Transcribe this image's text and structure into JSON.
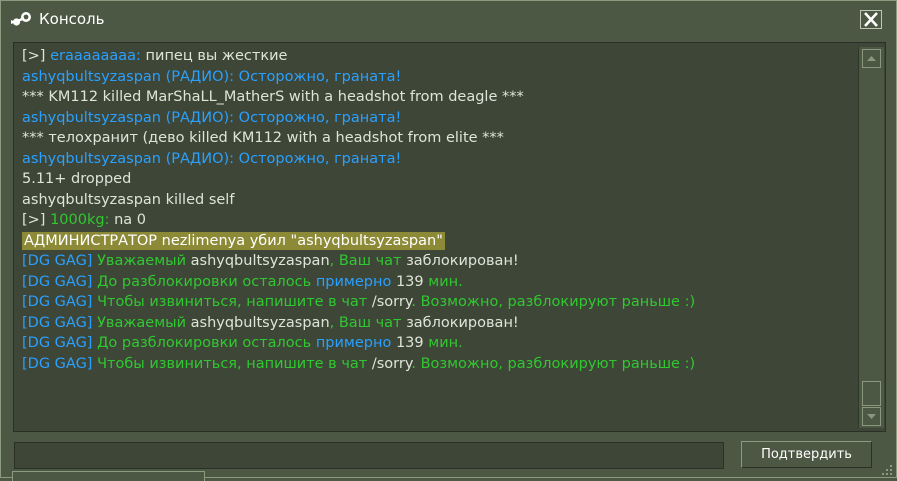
{
  "window": {
    "title": "Консоль",
    "icon": "steam-icon",
    "close_icon": "close-icon"
  },
  "colors": {
    "background": "#4c5844",
    "console_bg": "#3e4637",
    "text_default": "#dfe4d8",
    "radio_blue": "#2aa0ff",
    "green": "#30c830",
    "highlight_bg": "#8c8a37"
  },
  "console": {
    "lines": [
      [
        {
          "t": "[>] ",
          "c": "#dfe4d8"
        },
        {
          "t": "eraaaaaaaa:",
          "c": "#2aa0ff"
        },
        {
          "t": " пипец вы жесткие",
          "c": "#dfe4d8"
        }
      ],
      [
        {
          "t": "ashyqbultsyzaspan (РАДИО): Осторожно, граната!",
          "c": "#2aa0ff"
        }
      ],
      [
        {
          "t": "*** KM112 killed MarShaLL_MatherS with a headshot from deagle ***",
          "c": "#dfe4d8"
        }
      ],
      [
        {
          "t": "ashyqbultsyzaspan (РАДИО): Осторожно, граната!",
          "c": "#2aa0ff"
        }
      ],
      [
        {
          "t": "*** телохранит (дево killed KM112 with a headshot from elite ***",
          "c": "#dfe4d8"
        }
      ],
      [
        {
          "t": "ashyqbultsyzaspan (РАДИО): Осторожно, граната!",
          "c": "#2aa0ff"
        }
      ],
      [
        {
          "t": "5.11+ dropped",
          "c": "#dfe4d8"
        }
      ],
      [
        {
          "t": "ashyqbultsyzaspan killed self",
          "c": "#dfe4d8"
        }
      ],
      [
        {
          "t": "[>] ",
          "c": "#dfe4d8"
        },
        {
          "t": "1000kg:",
          "c": "#30c830"
        },
        {
          "t": " na 0",
          "c": "#dfe4d8"
        }
      ],
      [
        {
          "t": "АДМИНИСТРАТОР nezlimenya убил \"ashyqbultsyzaspan\"",
          "c": "#ffffff",
          "bg": "#8c8a37"
        }
      ],
      [
        {
          "t": "[DG GAG] ",
          "c": "#2aa0ff"
        },
        {
          "t": "Уважаемый ",
          "c": "#30c830"
        },
        {
          "t": "ashyqbultsyzaspan",
          "c": "#dfe4d8"
        },
        {
          "t": ", Ваш чат ",
          "c": "#30c830"
        },
        {
          "t": "заблокирован!",
          "c": "#dfe4d8"
        }
      ],
      [
        {
          "t": "[DG GAG] ",
          "c": "#2aa0ff"
        },
        {
          "t": "До разблокировки осталось ",
          "c": "#30c830"
        },
        {
          "t": "примерно ",
          "c": "#2aa0ff"
        },
        {
          "t": "139",
          "c": "#dfe4d8"
        },
        {
          "t": " мин.",
          "c": "#30c830"
        }
      ],
      [
        {
          "t": "[DG GAG] ",
          "c": "#2aa0ff"
        },
        {
          "t": "Чтобы извиниться, напишите в чат ",
          "c": "#30c830"
        },
        {
          "t": "/sorry",
          "c": "#dfe4d8"
        },
        {
          "t": ". Возможно, разблокируют раньше :)",
          "c": "#30c830"
        }
      ],
      [
        {
          "t": "[DG GAG] ",
          "c": "#2aa0ff"
        },
        {
          "t": "Уважаемый ",
          "c": "#30c830"
        },
        {
          "t": "ashyqbultsyzaspan",
          "c": "#dfe4d8"
        },
        {
          "t": ", Ваш чат ",
          "c": "#30c830"
        },
        {
          "t": "заблокирован!",
          "c": "#dfe4d8"
        }
      ],
      [
        {
          "t": "[DG GAG] ",
          "c": "#2aa0ff"
        },
        {
          "t": "До разблокировки осталось ",
          "c": "#30c830"
        },
        {
          "t": "примерно ",
          "c": "#2aa0ff"
        },
        {
          "t": "139",
          "c": "#dfe4d8"
        },
        {
          "t": " мин.",
          "c": "#30c830"
        }
      ],
      [
        {
          "t": "[DG GAG] ",
          "c": "#2aa0ff"
        },
        {
          "t": "Чтобы извиниться, напишите в чат ",
          "c": "#30c830"
        },
        {
          "t": "/sorry",
          "c": "#dfe4d8"
        },
        {
          "t": ". Возможно, разблокируют раньше :)",
          "c": "#30c830"
        }
      ]
    ]
  },
  "scrollbar": {
    "up_icon": "arrow-up-icon",
    "down_icon": "arrow-down-icon"
  },
  "command_input": {
    "value": "",
    "placeholder": ""
  },
  "submit_label": "Подтвердить",
  "resize_icon": "resize-grip-icon"
}
